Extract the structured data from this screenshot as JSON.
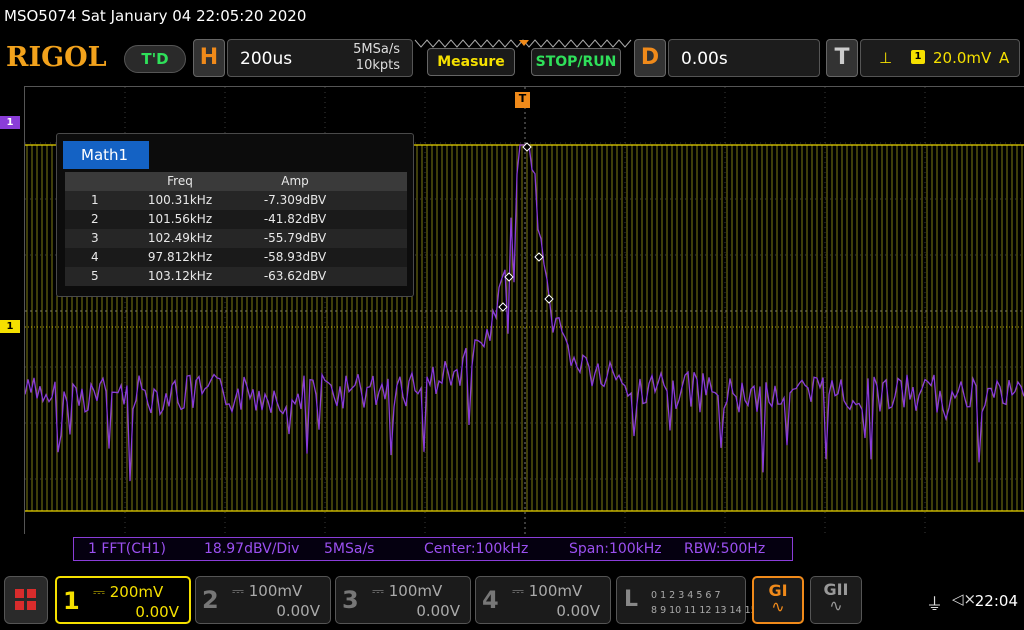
{
  "status_line": "MSO5074  Sat January 04 22:05:20 2020",
  "header": {
    "logo": "RIGOL",
    "trigger_state": "T'D",
    "horizontal": {
      "letter": "H",
      "timebase": "200us",
      "sample_rate": "5MSa/s",
      "points": "10kpts"
    },
    "buttons": {
      "measure": "Measure",
      "stop_run": "STOP/RUN"
    },
    "delay": {
      "letter": "D",
      "value": "0.00s"
    },
    "trigger": {
      "letter": "T",
      "source_badge": "1",
      "level": "20.0mV",
      "mode": "A"
    }
  },
  "markers": {
    "math_left": "1",
    "ch1_left": "1",
    "trigger_top": "T"
  },
  "fft_table": {
    "tab": "Math1",
    "headers": [
      "",
      "Freq",
      "Amp"
    ],
    "rows": [
      {
        "n": "1",
        "freq": "100.31kHz",
        "amp": "-7.309dBV"
      },
      {
        "n": "2",
        "freq": "101.56kHz",
        "amp": "-41.82dBV"
      },
      {
        "n": "3",
        "freq": "102.49kHz",
        "amp": "-55.79dBV"
      },
      {
        "n": "4",
        "freq": "97.812kHz",
        "amp": "-58.93dBV"
      },
      {
        "n": "5",
        "freq": "103.12kHz",
        "amp": "-63.62dBV"
      }
    ]
  },
  "math_status": {
    "label": "1 FFT(CH1)",
    "scale": "18.97dBV/Div",
    "rate": "5MSa/s",
    "center": "Center:100kHz",
    "span": "Span:100kHz",
    "rbw": "RBW:500Hz"
  },
  "channels": [
    {
      "num": "1",
      "scale": "200mV",
      "offset": "0.00V",
      "active": true
    },
    {
      "num": "2",
      "scale": "100mV",
      "offset": "0.00V",
      "active": false
    },
    {
      "num": "3",
      "scale": "100mV",
      "offset": "0.00V",
      "active": false
    },
    {
      "num": "4",
      "scale": "100mV",
      "offset": "0.00V",
      "active": false
    }
  ],
  "logic": {
    "letter": "L",
    "row1": "0 1 2 3  4 5 6 7",
    "row2": "8 9 10 11 12 13 14 15"
  },
  "generators": {
    "g1": "GI",
    "g2": "GII"
  },
  "clock": "22:04",
  "colors": {
    "ch1": "#f5e000",
    "math": "#8a3dd8",
    "accent": "#f08a1a",
    "green": "#2fe05a"
  }
}
